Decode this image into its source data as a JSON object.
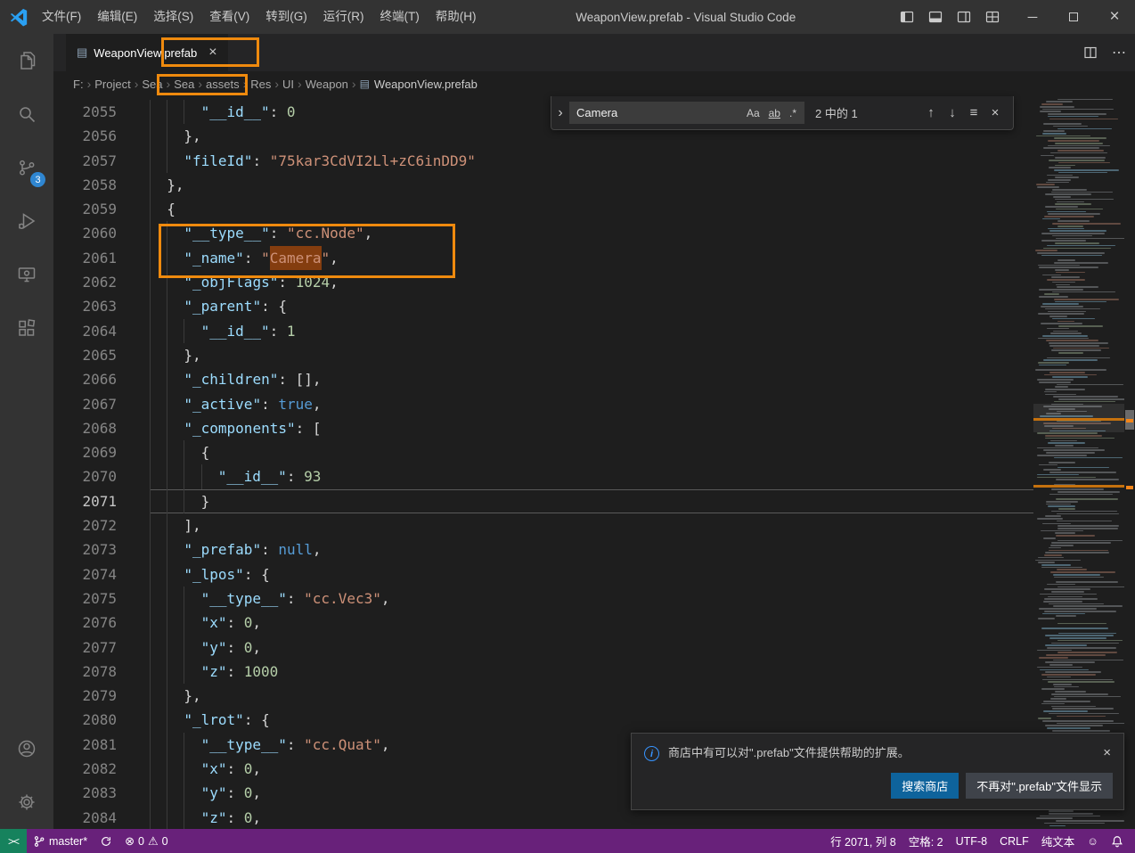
{
  "title_bar": {
    "menus": [
      "文件(F)",
      "编辑(E)",
      "选择(S)",
      "查看(V)",
      "转到(G)",
      "运行(R)",
      "终端(T)",
      "帮助(H)"
    ],
    "title": "WeaponView.prefab - Visual Studio Code"
  },
  "activity_bar": {
    "scm_badge": "3"
  },
  "tab": {
    "label": "WeaponView.prefab"
  },
  "breadcrumb": {
    "items": [
      "F:",
      "Project",
      "Sea",
      "Sea",
      "assets",
      "Res",
      "UI",
      "Weapon",
      "WeaponView.prefab"
    ]
  },
  "find": {
    "query": "Camera",
    "case": "Aa",
    "word": "ab",
    "regex": ".*",
    "count": "2 中的 1"
  },
  "icons": {
    "close": "×",
    "chevron_right": "›",
    "arrow_up": "↑",
    "arrow_down": "↓",
    "selection": "≡",
    "more": "⋯",
    "file": "▤",
    "error": "⊗",
    "warning": "⚠",
    "smiley": "☺",
    "minimize": "─",
    "info": "i"
  },
  "editor": {
    "lines": [
      {
        "n": 2055,
        "i": 6,
        "t": [
          [
            "k",
            "\"__id__\""
          ],
          [
            "p",
            ": "
          ],
          [
            "n",
            "0"
          ]
        ]
      },
      {
        "n": 2056,
        "i": 4,
        "t": [
          [
            "p",
            "},"
          ]
        ]
      },
      {
        "n": 2057,
        "i": 4,
        "t": [
          [
            "k",
            "\"fileId\""
          ],
          [
            "p",
            ": "
          ],
          [
            "s",
            "\"75kar3CdVI2Ll+zC6inDD9\""
          ]
        ]
      },
      {
        "n": 2058,
        "i": 2,
        "t": [
          [
            "p",
            "},"
          ]
        ]
      },
      {
        "n": 2059,
        "i": 2,
        "t": [
          [
            "p",
            "{"
          ]
        ]
      },
      {
        "n": 2060,
        "i": 4,
        "t": [
          [
            "k",
            "\"__type__\""
          ],
          [
            "p",
            ": "
          ],
          [
            "s",
            "\"cc.Node\""
          ],
          [
            "p",
            ","
          ]
        ]
      },
      {
        "n": 2061,
        "i": 4,
        "t": [
          [
            "k",
            "\"_name\""
          ],
          [
            "p",
            ": "
          ],
          [
            "s",
            "\""
          ],
          [
            "sh",
            "Camera"
          ],
          [
            "s",
            "\""
          ],
          [
            "p",
            ","
          ]
        ]
      },
      {
        "n": 2062,
        "i": 4,
        "t": [
          [
            "k",
            "\"_objFlags\""
          ],
          [
            "p",
            ": "
          ],
          [
            "n",
            "1024"
          ],
          [
            "p",
            ","
          ]
        ]
      },
      {
        "n": 2063,
        "i": 4,
        "t": [
          [
            "k",
            "\"_parent\""
          ],
          [
            "p",
            ": {"
          ]
        ]
      },
      {
        "n": 2064,
        "i": 6,
        "t": [
          [
            "k",
            "\"__id__\""
          ],
          [
            "p",
            ": "
          ],
          [
            "n",
            "1"
          ]
        ]
      },
      {
        "n": 2065,
        "i": 4,
        "t": [
          [
            "p",
            "},"
          ]
        ]
      },
      {
        "n": 2066,
        "i": 4,
        "t": [
          [
            "k",
            "\"_children\""
          ],
          [
            "p",
            ": [],"
          ]
        ]
      },
      {
        "n": 2067,
        "i": 4,
        "t": [
          [
            "k",
            "\"_active\""
          ],
          [
            "p",
            ": "
          ],
          [
            "w",
            "true"
          ],
          [
            "p",
            ","
          ]
        ]
      },
      {
        "n": 2068,
        "i": 4,
        "t": [
          [
            "k",
            "\"_components\""
          ],
          [
            "p",
            ": ["
          ]
        ]
      },
      {
        "n": 2069,
        "i": 6,
        "t": [
          [
            "p",
            "{"
          ]
        ]
      },
      {
        "n": 2070,
        "i": 8,
        "t": [
          [
            "k",
            "\"__id__\""
          ],
          [
            "p",
            ": "
          ],
          [
            "n",
            "93"
          ]
        ]
      },
      {
        "n": 2071,
        "i": 6,
        "cur": true,
        "t": [
          [
            "p",
            "}"
          ]
        ]
      },
      {
        "n": 2072,
        "i": 4,
        "t": [
          [
            "p",
            "],"
          ]
        ]
      },
      {
        "n": 2073,
        "i": 4,
        "t": [
          [
            "k",
            "\"_prefab\""
          ],
          [
            "p",
            ": "
          ],
          [
            "w",
            "null"
          ],
          [
            "p",
            ","
          ]
        ]
      },
      {
        "n": 2074,
        "i": 4,
        "t": [
          [
            "k",
            "\"_lpos\""
          ],
          [
            "p",
            ": {"
          ]
        ]
      },
      {
        "n": 2075,
        "i": 6,
        "t": [
          [
            "k",
            "\"__type__\""
          ],
          [
            "p",
            ": "
          ],
          [
            "s",
            "\"cc.Vec3\""
          ],
          [
            "p",
            ","
          ]
        ]
      },
      {
        "n": 2076,
        "i": 6,
        "t": [
          [
            "k",
            "\"x\""
          ],
          [
            "p",
            ": "
          ],
          [
            "n",
            "0"
          ],
          [
            "p",
            ","
          ]
        ]
      },
      {
        "n": 2077,
        "i": 6,
        "t": [
          [
            "k",
            "\"y\""
          ],
          [
            "p",
            ": "
          ],
          [
            "n",
            "0"
          ],
          [
            "p",
            ","
          ]
        ]
      },
      {
        "n": 2078,
        "i": 6,
        "t": [
          [
            "k",
            "\"z\""
          ],
          [
            "p",
            ": "
          ],
          [
            "n",
            "1000"
          ]
        ]
      },
      {
        "n": 2079,
        "i": 4,
        "t": [
          [
            "p",
            "},"
          ]
        ]
      },
      {
        "n": 2080,
        "i": 4,
        "t": [
          [
            "k",
            "\"_lrot\""
          ],
          [
            "p",
            ": {"
          ]
        ]
      },
      {
        "n": 2081,
        "i": 6,
        "t": [
          [
            "k",
            "\"__type__\""
          ],
          [
            "p",
            ": "
          ],
          [
            "s",
            "\"cc.Quat\""
          ],
          [
            "p",
            ","
          ]
        ]
      },
      {
        "n": 2082,
        "i": 6,
        "t": [
          [
            "k",
            "\"x\""
          ],
          [
            "p",
            ": "
          ],
          [
            "n",
            "0"
          ],
          [
            "p",
            ","
          ]
        ]
      },
      {
        "n": 2083,
        "i": 6,
        "t": [
          [
            "k",
            "\"y\""
          ],
          [
            "p",
            ": "
          ],
          [
            "n",
            "0"
          ],
          [
            "p",
            ","
          ]
        ]
      },
      {
        "n": 2084,
        "i": 6,
        "t": [
          [
            "k",
            "\"z\""
          ],
          [
            "p",
            ": "
          ],
          [
            "n",
            "0"
          ],
          [
            "p",
            ","
          ]
        ]
      }
    ]
  },
  "notification": {
    "message": "商店中有可以对\".prefab\"文件提供帮助的扩展。",
    "primary": "搜索商店",
    "secondary": "不再对\".prefab\"文件显示"
  },
  "status_bar": {
    "remote": "><",
    "branch": "master*",
    "errors": "0",
    "warnings": "0",
    "line_col": "行 2071, 列 8",
    "indent": "空格: 2",
    "encoding": "UTF-8",
    "eol": "CRLF",
    "language": "纯文本"
  },
  "colors": {
    "status_bar": "#68217a",
    "remote_indicator": "#16825d",
    "badge": "#2f86d1",
    "annotation": "#ef8a0e",
    "find_match": "#ea5c00",
    "accent": "#007acc",
    "syntax": {
      "key": "#9cdcfe",
      "string": "#ce9178",
      "number": "#b5cea8",
      "keyword": "#569cd6",
      "punctuation": "#d4d4d4"
    }
  }
}
